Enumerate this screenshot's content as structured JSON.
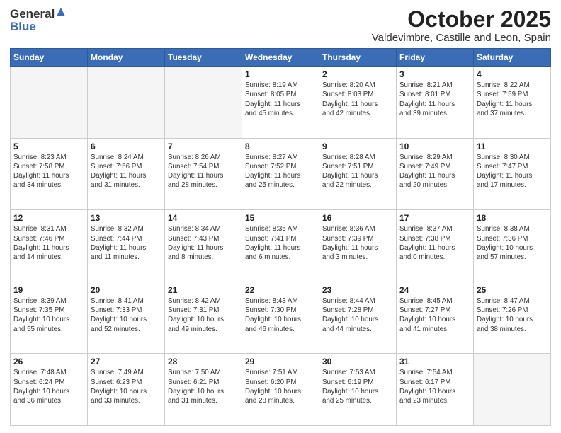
{
  "header": {
    "logo_general": "General",
    "logo_blue": "Blue",
    "title": "October 2025",
    "subtitle": "Valdevimbre, Castille and Leon, Spain"
  },
  "weekdays": [
    "Sunday",
    "Monday",
    "Tuesday",
    "Wednesday",
    "Thursday",
    "Friday",
    "Saturday"
  ],
  "weeks": [
    [
      {
        "day": "",
        "info": ""
      },
      {
        "day": "",
        "info": ""
      },
      {
        "day": "",
        "info": ""
      },
      {
        "day": "1",
        "info": "Sunrise: 8:19 AM\nSunset: 8:05 PM\nDaylight: 11 hours\nand 45 minutes."
      },
      {
        "day": "2",
        "info": "Sunrise: 8:20 AM\nSunset: 8:03 PM\nDaylight: 11 hours\nand 42 minutes."
      },
      {
        "day": "3",
        "info": "Sunrise: 8:21 AM\nSunset: 8:01 PM\nDaylight: 11 hours\nand 39 minutes."
      },
      {
        "day": "4",
        "info": "Sunrise: 8:22 AM\nSunset: 7:59 PM\nDaylight: 11 hours\nand 37 minutes."
      }
    ],
    [
      {
        "day": "5",
        "info": "Sunrise: 8:23 AM\nSunset: 7:58 PM\nDaylight: 11 hours\nand 34 minutes."
      },
      {
        "day": "6",
        "info": "Sunrise: 8:24 AM\nSunset: 7:56 PM\nDaylight: 11 hours\nand 31 minutes."
      },
      {
        "day": "7",
        "info": "Sunrise: 8:26 AM\nSunset: 7:54 PM\nDaylight: 11 hours\nand 28 minutes."
      },
      {
        "day": "8",
        "info": "Sunrise: 8:27 AM\nSunset: 7:52 PM\nDaylight: 11 hours\nand 25 minutes."
      },
      {
        "day": "9",
        "info": "Sunrise: 8:28 AM\nSunset: 7:51 PM\nDaylight: 11 hours\nand 22 minutes."
      },
      {
        "day": "10",
        "info": "Sunrise: 8:29 AM\nSunset: 7:49 PM\nDaylight: 11 hours\nand 20 minutes."
      },
      {
        "day": "11",
        "info": "Sunrise: 8:30 AM\nSunset: 7:47 PM\nDaylight: 11 hours\nand 17 minutes."
      }
    ],
    [
      {
        "day": "12",
        "info": "Sunrise: 8:31 AM\nSunset: 7:46 PM\nDaylight: 11 hours\nand 14 minutes."
      },
      {
        "day": "13",
        "info": "Sunrise: 8:32 AM\nSunset: 7:44 PM\nDaylight: 11 hours\nand 11 minutes."
      },
      {
        "day": "14",
        "info": "Sunrise: 8:34 AM\nSunset: 7:43 PM\nDaylight: 11 hours\nand 8 minutes."
      },
      {
        "day": "15",
        "info": "Sunrise: 8:35 AM\nSunset: 7:41 PM\nDaylight: 11 hours\nand 6 minutes."
      },
      {
        "day": "16",
        "info": "Sunrise: 8:36 AM\nSunset: 7:39 PM\nDaylight: 11 hours\nand 3 minutes."
      },
      {
        "day": "17",
        "info": "Sunrise: 8:37 AM\nSunset: 7:38 PM\nDaylight: 11 hours\nand 0 minutes."
      },
      {
        "day": "18",
        "info": "Sunrise: 8:38 AM\nSunset: 7:36 PM\nDaylight: 10 hours\nand 57 minutes."
      }
    ],
    [
      {
        "day": "19",
        "info": "Sunrise: 8:39 AM\nSunset: 7:35 PM\nDaylight: 10 hours\nand 55 minutes."
      },
      {
        "day": "20",
        "info": "Sunrise: 8:41 AM\nSunset: 7:33 PM\nDaylight: 10 hours\nand 52 minutes."
      },
      {
        "day": "21",
        "info": "Sunrise: 8:42 AM\nSunset: 7:31 PM\nDaylight: 10 hours\nand 49 minutes."
      },
      {
        "day": "22",
        "info": "Sunrise: 8:43 AM\nSunset: 7:30 PM\nDaylight: 10 hours\nand 46 minutes."
      },
      {
        "day": "23",
        "info": "Sunrise: 8:44 AM\nSunset: 7:28 PM\nDaylight: 10 hours\nand 44 minutes."
      },
      {
        "day": "24",
        "info": "Sunrise: 8:45 AM\nSunset: 7:27 PM\nDaylight: 10 hours\nand 41 minutes."
      },
      {
        "day": "25",
        "info": "Sunrise: 8:47 AM\nSunset: 7:26 PM\nDaylight: 10 hours\nand 38 minutes."
      }
    ],
    [
      {
        "day": "26",
        "info": "Sunrise: 7:48 AM\nSunset: 6:24 PM\nDaylight: 10 hours\nand 36 minutes."
      },
      {
        "day": "27",
        "info": "Sunrise: 7:49 AM\nSunset: 6:23 PM\nDaylight: 10 hours\nand 33 minutes."
      },
      {
        "day": "28",
        "info": "Sunrise: 7:50 AM\nSunset: 6:21 PM\nDaylight: 10 hours\nand 31 minutes."
      },
      {
        "day": "29",
        "info": "Sunrise: 7:51 AM\nSunset: 6:20 PM\nDaylight: 10 hours\nand 28 minutes."
      },
      {
        "day": "30",
        "info": "Sunrise: 7:53 AM\nSunset: 6:19 PM\nDaylight: 10 hours\nand 25 minutes."
      },
      {
        "day": "31",
        "info": "Sunrise: 7:54 AM\nSunset: 6:17 PM\nDaylight: 10 hours\nand 23 minutes."
      },
      {
        "day": "",
        "info": ""
      }
    ]
  ]
}
